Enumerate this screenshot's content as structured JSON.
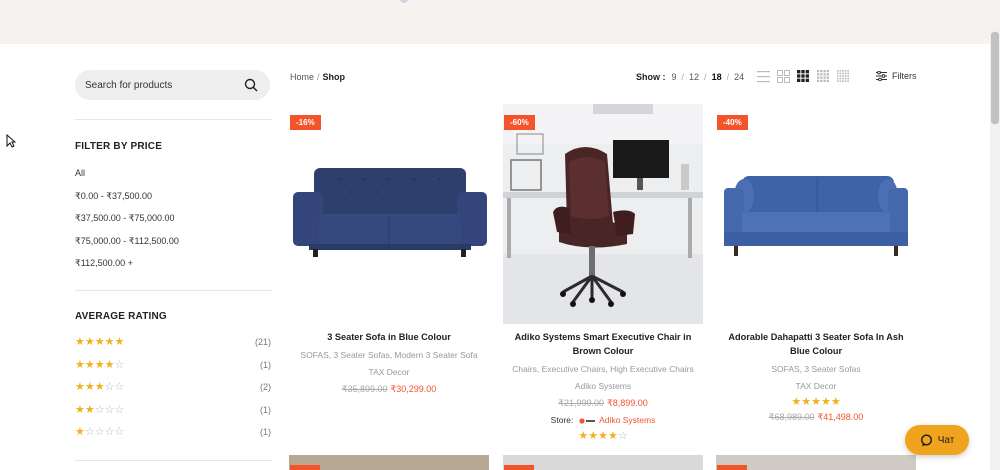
{
  "search": {
    "placeholder": "Search for products"
  },
  "price_filter": {
    "title": "FILTER BY PRICE",
    "options": [
      "All",
      "₹0.00 - ₹37,500.00",
      "₹37,500.00 - ₹75,000.00",
      "₹75,000.00 - ₹112,500.00",
      "₹112,500.00 +"
    ]
  },
  "rating_filter": {
    "title": "AVERAGE RATING",
    "options": [
      {
        "stars": 5,
        "count": "(21)"
      },
      {
        "stars": 4,
        "count": "(1)"
      },
      {
        "stars": 3,
        "count": "(2)"
      },
      {
        "stars": 2,
        "count": "(1)"
      },
      {
        "stars": 1,
        "count": "(1)"
      }
    ]
  },
  "breadcrumb": {
    "home": "Home",
    "sep": "/",
    "current": "Shop"
  },
  "show": {
    "label": "Show :",
    "options": [
      "9",
      "12",
      "18",
      "24"
    ],
    "active": "18"
  },
  "view_icons": [
    "list-view-icon",
    "grid-2-icon",
    "grid-3-icon",
    "grid-4-icon",
    "grid-5-icon"
  ],
  "filters": {
    "label": "Filters"
  },
  "products": [
    {
      "badge": "-16%",
      "name": "3 Seater Sofa in Blue Colour",
      "categories": "SOFAS, 3 Seater Sofas, Modern 3 Seater Sofa",
      "brand": "TAX Decor",
      "old_price": "₹35,899.00",
      "price": "₹30,299.00"
    },
    {
      "badge": "-60%",
      "name": "Adiko Systems Smart Executive Chair in Brown Colour",
      "categories": "Chairs, Executive Chairs, High Executive Chairs",
      "brand": "Adiko Systems",
      "old_price": "₹21,999.00",
      "price": "₹8,899.00",
      "store_label": "Store:",
      "store_name": "Adiko Systems",
      "rating": 4
    },
    {
      "badge": "-40%",
      "name": "Adorable Dahapatti 3 Seater Sofa In Ash Blue Colour",
      "categories": "SOFAS, 3 Seater Sofas",
      "brand": "TAX Decor",
      "old_price": "₹68,989.00",
      "price": "₹41,498.00",
      "rating": 5
    }
  ],
  "chat": {
    "label": "Чат"
  },
  "colors": {
    "accent": "#f4542a",
    "star": "#f2b01e",
    "chat": "#f0a31c",
    "header_bg": "#f6f2ef"
  }
}
